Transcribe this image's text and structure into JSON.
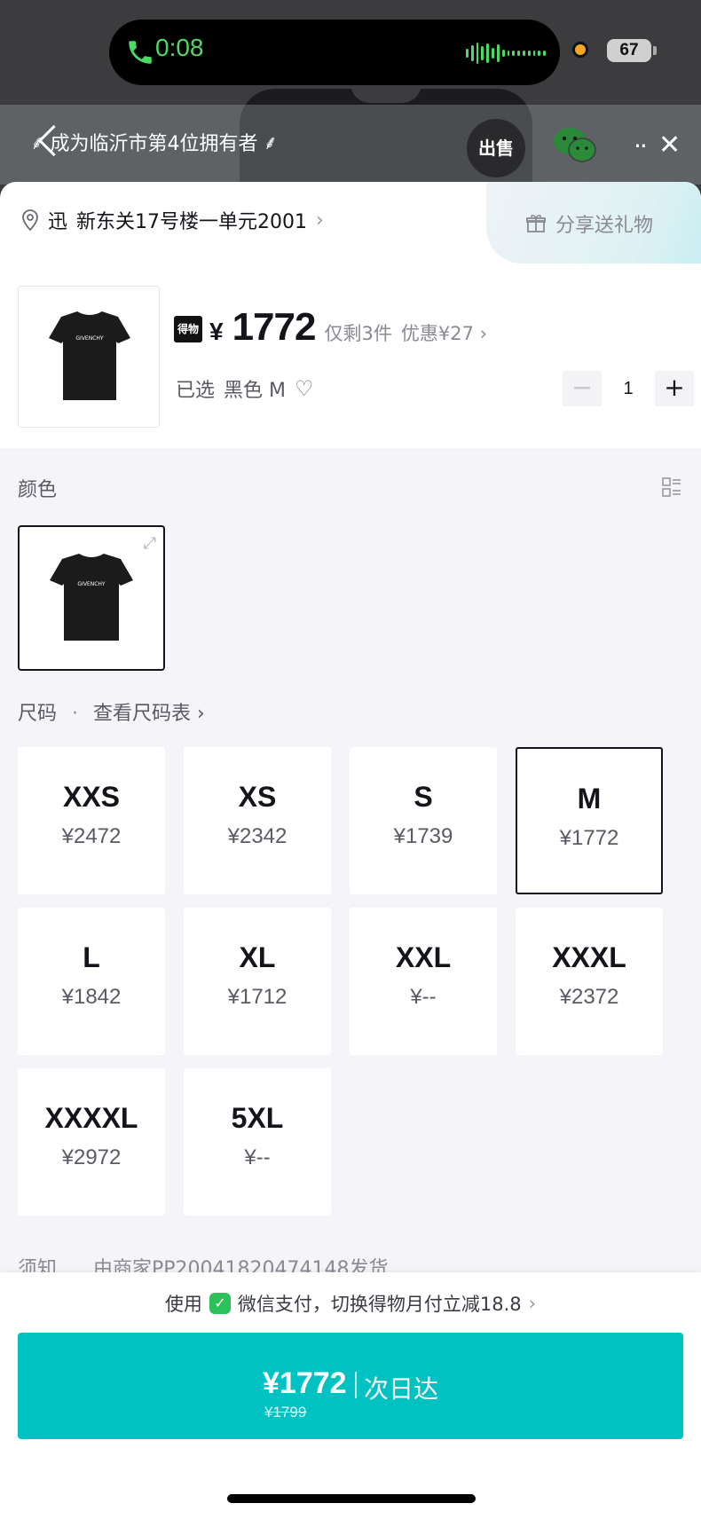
{
  "status": {
    "call_time": "0:08",
    "battery": "67"
  },
  "header": {
    "owner_banner": "成为临沂市第4位拥有者",
    "sell_label": "出售"
  },
  "address": {
    "tag": "迅",
    "text": "新东关17号楼一单元2001",
    "gift_label": "分享送礼物"
  },
  "product": {
    "badge": "得物",
    "currency": "¥",
    "price": "1772",
    "stock": "仅剩3件",
    "discount": "优惠¥27",
    "selected_prefix": "已选",
    "selected_value": "黑色 M",
    "quantity": "1",
    "brand_print": "GIVENCHY"
  },
  "color_section": {
    "label": "颜色"
  },
  "size_section": {
    "label": "尺码",
    "chart_link": "查看尺码表",
    "sizes": [
      {
        "name": "XXS",
        "price": "¥2472",
        "selected": false
      },
      {
        "name": "XS",
        "price": "¥2342",
        "selected": false
      },
      {
        "name": "S",
        "price": "¥1739",
        "selected": false
      },
      {
        "name": "M",
        "price": "¥1772",
        "selected": true
      },
      {
        "name": "L",
        "price": "¥1842",
        "selected": false
      },
      {
        "name": "XL",
        "price": "¥1712",
        "selected": false
      },
      {
        "name": "XXL",
        "price": "¥--",
        "selected": false
      },
      {
        "name": "XXXL",
        "price": "¥2372",
        "selected": false
      },
      {
        "name": "XXXXL",
        "price": "¥2972",
        "selected": false
      },
      {
        "name": "5XL",
        "price": "¥--",
        "selected": false
      }
    ]
  },
  "notice": {
    "label": "须知",
    "text": "由商家PP20041820474148发货"
  },
  "payment": {
    "prefix": "使用",
    "text": "微信支付，切换得物月付立减18.8"
  },
  "buy": {
    "price": "¥1772",
    "label": "次日达",
    "original_price": "¥1799"
  },
  "colors": {
    "accent": "#01c2c3",
    "text": "#14151a",
    "wechat_green": "#2dc15a"
  }
}
